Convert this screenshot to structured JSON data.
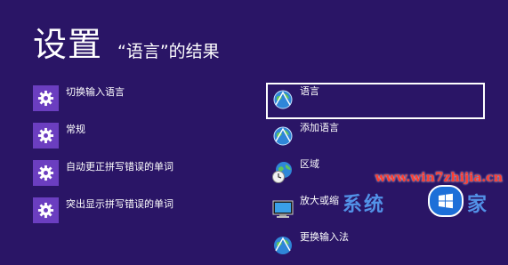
{
  "header": {
    "title": "设置",
    "subtitle": "“语言”的结果"
  },
  "settings_results": [
    {
      "label": "切换输入语言",
      "icon": "gear-icon"
    },
    {
      "label": "常规",
      "icon": "gear-icon"
    },
    {
      "label": "自动更正拼写错误的单词",
      "icon": "gear-icon"
    },
    {
      "label": "突出显示拼写错误的单词",
      "icon": "gear-icon"
    }
  ],
  "control_panel_results": [
    {
      "label": "语言",
      "icon": "language-globe-icon"
    },
    {
      "label": "添加语言",
      "icon": "language-globe-icon"
    },
    {
      "label": "区域",
      "icon": "region-clock-globe-icon"
    },
    {
      "label": "放大或缩",
      "icon": "monitor-icon"
    },
    {
      "label": "更换输入法",
      "icon": "language-globe-icon"
    }
  ],
  "watermark": {
    "url": "www.win7zhijia.cn",
    "logo_text": "系统",
    "logo_text_2": "家"
  },
  "colors": {
    "background": "#2a1566",
    "tile": "#6b3ec0",
    "watermark_red": "#ff3b2f",
    "logo_blue": "#1d6fd8"
  }
}
